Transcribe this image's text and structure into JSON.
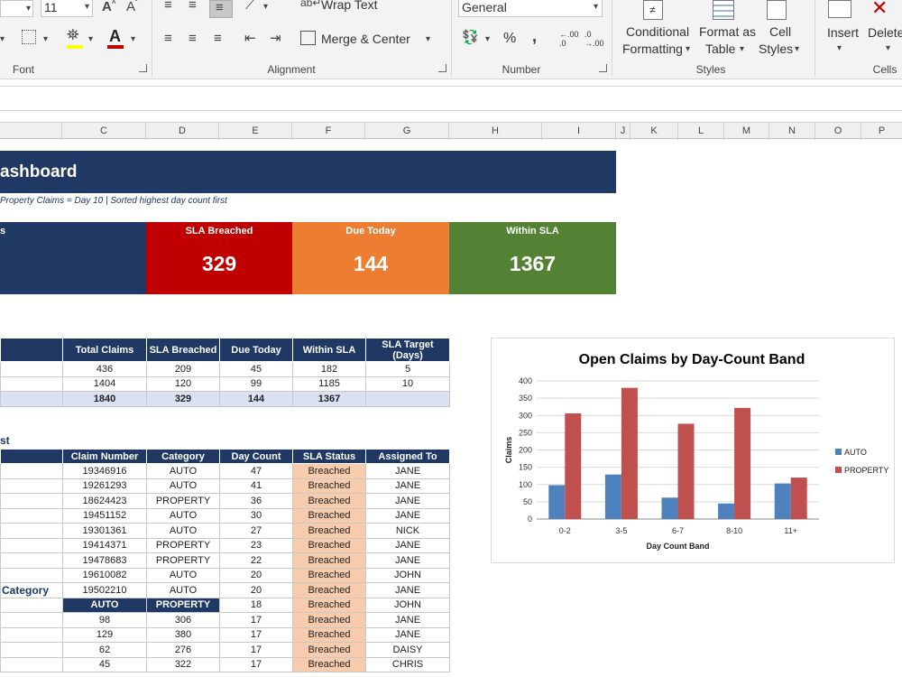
{
  "ribbon": {
    "font_size": "11",
    "font_group_label": "Font",
    "alignment_group_label": "Alignment",
    "wrap_text": "Wrap Text",
    "merge_center": "Merge & Center",
    "number_format": "General",
    "number_group_label": "Number",
    "percent": "%",
    "comma": ",",
    "inc_decimal": ".00",
    "dec_decimal": ".00",
    "conditional_formatting_line1": "Conditional",
    "conditional_formatting_line2": "Formatting",
    "format_as_table_line1": "Format as",
    "format_as_table_line2": "Table",
    "cell_styles_line1": "Cell",
    "cell_styles_line2": "Styles",
    "styles_group_label": "Styles",
    "insert": "Insert",
    "delete": "Delete",
    "cells_group_label": "Cells",
    "font_color": "#c00000",
    "fill_color": "#ffff00"
  },
  "columns": [
    "C",
    "D",
    "E",
    "F",
    "G",
    "H",
    "I",
    "J",
    "K",
    "L",
    "M",
    "N",
    "O",
    "P"
  ],
  "dashboard": {
    "title": "ashboard",
    "subtitle": "Property Claims = Day 10   |   Sorted highest day count first",
    "kpi_partial_label": "s",
    "kpis": [
      {
        "label": "SLA Breached",
        "value": "329",
        "color": "#c00000"
      },
      {
        "label": "Due Today",
        "value": "144",
        "color": "#ed7d31"
      },
      {
        "label": "Within SLA",
        "value": "1367",
        "color": "#548235"
      }
    ]
  },
  "summary_table": {
    "headers": [
      "Total Claims",
      "SLA Breached",
      "Due Today",
      "Within SLA",
      "SLA Target (Days)"
    ],
    "rows": [
      [
        "436",
        "209",
        "45",
        "182",
        "5"
      ],
      [
        "1404",
        "120",
        "99",
        "1185",
        "10"
      ]
    ],
    "total": [
      "1840",
      "329",
      "144",
      "1367",
      ""
    ]
  },
  "list_section_partial_title": "st",
  "claims_table": {
    "headers": [
      "Claim Number",
      "Category",
      "Day Count",
      "SLA Status",
      "Assigned To"
    ],
    "rows": [
      [
        "19346916",
        "AUTO",
        "47",
        "Breached",
        "JANE"
      ],
      [
        "19261293",
        "AUTO",
        "41",
        "Breached",
        "JANE"
      ],
      [
        "18624423",
        "PROPERTY",
        "36",
        "Breached",
        "JANE"
      ],
      [
        "19451152",
        "AUTO",
        "30",
        "Breached",
        "JANE"
      ],
      [
        "19301361",
        "AUTO",
        "27",
        "Breached",
        "NICK"
      ],
      [
        "19414371",
        "PROPERTY",
        "23",
        "Breached",
        "JANE"
      ],
      [
        "19478683",
        "PROPERTY",
        "22",
        "Breached",
        "JANE"
      ],
      [
        "19610082",
        "AUTO",
        "20",
        "Breached",
        "JOHN"
      ],
      [
        "19502210",
        "AUTO",
        "20",
        "Breached",
        "JANE"
      ],
      [
        "AUTO",
        "PROPERTY",
        "18",
        "Breached",
        "JOHN"
      ],
      [
        "98",
        "306",
        "17",
        "Breached",
        "JANE"
      ],
      [
        "129",
        "380",
        "17",
        "Breached",
        "JANE"
      ],
      [
        "62",
        "276",
        "17",
        "Breached",
        "DAISY"
      ],
      [
        "45",
        "322",
        "17",
        "Breached",
        "CHRIS"
      ]
    ]
  },
  "category_section_partial_title": "Category",
  "chart_data": {
    "type": "bar",
    "title": "Open Claims by Day-Count Band",
    "xlabel": "Day Count Band",
    "ylabel": "Claims",
    "categories": [
      "0-2",
      "3-5",
      "6-7",
      "8-10",
      "11+"
    ],
    "series": [
      {
        "name": "AUTO",
        "values": [
          98,
          129,
          62,
          45,
          103
        ],
        "color": "#4f81bd"
      },
      {
        "name": "PROPERTY",
        "values": [
          306,
          380,
          276,
          322,
          120
        ],
        "color": "#c0504d"
      }
    ],
    "ylim": [
      0,
      400
    ],
    "yticks": [
      "0",
      "50",
      "100",
      "150",
      "200",
      "250",
      "300",
      "350",
      "400"
    ],
    "grid": true,
    "legend": "right"
  }
}
